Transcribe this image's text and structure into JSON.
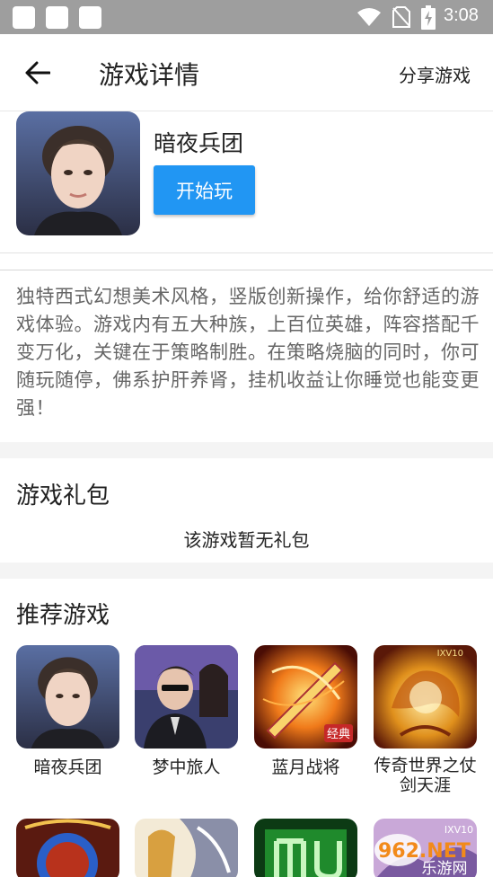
{
  "status_bar": {
    "time": "3:08",
    "icons": [
      "notification-square",
      "notification-square",
      "notification-square",
      "wifi-icon",
      "no-sim-icon",
      "battery-charging-icon"
    ]
  },
  "header": {
    "back_icon": "arrow-left-icon",
    "title": "游戏详情",
    "share_label": "分享游戏"
  },
  "game": {
    "name": "暗夜兵团",
    "play_label": "开始玩",
    "description": "独特西式幻想美术风格，竖版创新操作，给你舒适的游戏体验。游戏内有五大种族，上百位英雄，阵容搭配千变万化，关键在于策略制胜。在策略烧脑的同时，你可随玩随停，佛系护肝养肾，挂机收益让你睡觉也能变更强！"
  },
  "gifts": {
    "title": "游戏礼包",
    "empty_text": "该游戏暂无礼包"
  },
  "recommended": {
    "title": "推荐游戏",
    "items": [
      {
        "label": "暗夜兵团"
      },
      {
        "label": "梦中旅人"
      },
      {
        "label": "蓝月战将",
        "badge": "经典"
      },
      {
        "label": "传奇世界之仗剑天涯",
        "badge": "IXV10"
      }
    ],
    "row2_badge": "IXV10"
  },
  "watermark": {
    "text_top": "962.NET",
    "text_bottom": "乐游网"
  },
  "colors": {
    "accent": "#2196f3",
    "status_bar": "#9e9e9e",
    "section_gap": "#f4f4f4"
  }
}
